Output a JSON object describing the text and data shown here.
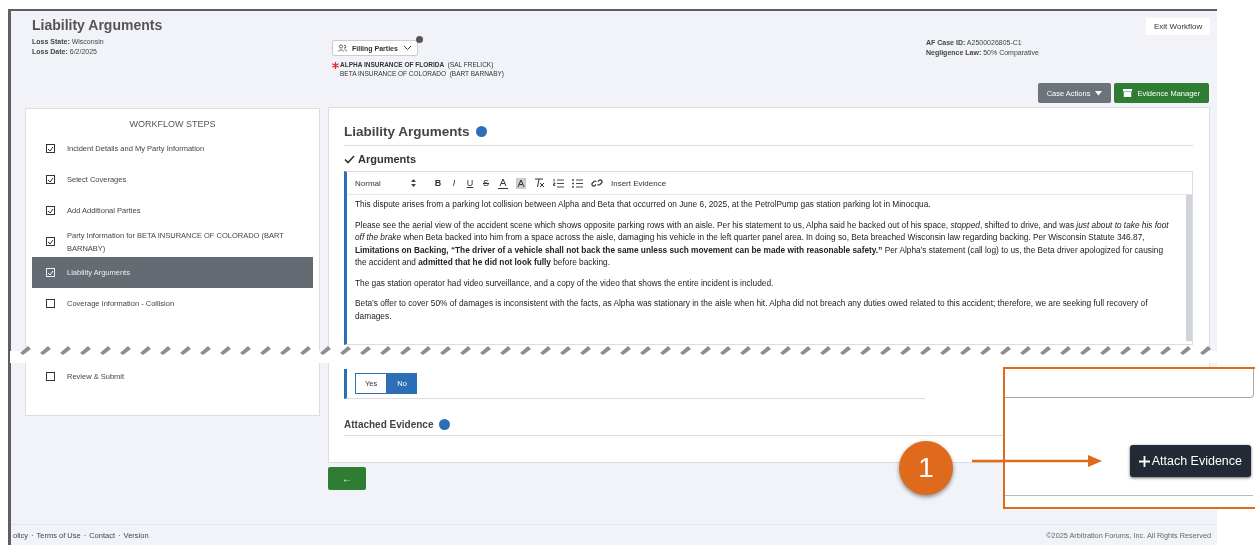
{
  "header": {
    "title": "Liability Arguments",
    "meta": [
      {
        "label": "Loss State:",
        "value": "Wisconsin"
      },
      {
        "label": "Loss Date:",
        "value": "6/2/2025"
      }
    ]
  },
  "parties": {
    "dropdown": "Filling Parties",
    "items": [
      {
        "name": "ALPHA INSURANCE OF FLORIDA",
        "contact": "(SAL FRELICK)",
        "primary": true
      },
      {
        "name": "BETA INSURANCE OF COLORADO",
        "contact": "(BART BARNABY)",
        "primary": false
      }
    ]
  },
  "case_info": [
    {
      "label": "AF Case ID:",
      "value": "A2500026805-C1"
    },
    {
      "label": "Negligence Law:",
      "value": "50% Comparative"
    }
  ],
  "exit_button": "Exit Workflow",
  "actions": [
    {
      "kind": "dropdown",
      "label": "Case Actions"
    },
    {
      "kind": "evidence",
      "label": "Evidence Manager"
    }
  ],
  "workflow": {
    "title": "WORKFLOW STEPS",
    "steps": [
      {
        "label": "Incident Details and My Party Information",
        "checked": true,
        "selected": false
      },
      {
        "label": "Select Coverages",
        "checked": true,
        "selected": false
      },
      {
        "label": "Add Additional Parties",
        "checked": true,
        "selected": false
      },
      {
        "label": "Party Information for BETA INSURANCE OF COLORADO (BART BARNABY)",
        "checked": true,
        "selected": false
      },
      {
        "label": "Liability Arguments",
        "checked": true,
        "selected": true
      },
      {
        "label": "Coverage Information - Collision",
        "checked": false,
        "selected": false
      }
    ],
    "steps_after_tear": [
      {
        "label": "Review & Submit",
        "checked": false,
        "selected": false
      }
    ]
  },
  "main": {
    "title": "Liability Arguments",
    "section": "Arguments",
    "toolbar": {
      "format": "Normal",
      "marks": [
        {
          "kind": "bold",
          "label": "B"
        },
        {
          "kind": "italic",
          "label": "I"
        },
        {
          "kind": "underline",
          "label": "U"
        },
        {
          "kind": "strike",
          "label": "S"
        }
      ],
      "insert": "Insert Evidence"
    },
    "paragraphs": [
      "This dispute arises from a parking lot collision between Alpha and Beta that occurred on June 6, 2025, at the PetrolPump gas station parking lot in Minocqua.",
      "Please see the aerial view of the accident scene which shows opposite parking rows with an aisle. Per his statement to us, Alpha said he backed out of his space, *stopped*, shifted to drive, and was *just about to take his foot off the brake* when Beta backed into him from a space across the aisle, damaging his vehicle in the left quarter panel area. In doing so, Beta breached Wisconsin law regarding backing. Per Wisconsin Statute 346.87, **Limitations on Backing, “The driver of a vehicle shall not back the same unless such movement can be made with reasonable safety.”** Per Alpha’s statement (call log) to us, the Beta driver apologized for causing the accident and **admitted that he did not look fully** before backing.",
      "The gas station operator had video surveillance, and a copy of the video that shows the entire incident is included.",
      "Beta’s offer to cover 50% of damages is inconsistent with the facts, as Alpha was stationary in the aisle when hit.  Alpha did not breach any duties owed related to this accident; therefore, we are seeking full recovery of damages."
    ],
    "answers": [
      {
        "label": "Yes",
        "selected": false
      },
      {
        "label": "No",
        "selected": true
      }
    ],
    "evidence_title": "Attached Evidence",
    "back_button": "←"
  },
  "callout": {
    "number": "1",
    "button": "Attach Evidence"
  },
  "footer": {
    "links": [
      "olicy",
      "Terms of Use",
      "Contact",
      "Version"
    ],
    "separator": "·",
    "copyright": "©2025 Arbitration Forums, Inc. All Rights Reserved"
  }
}
